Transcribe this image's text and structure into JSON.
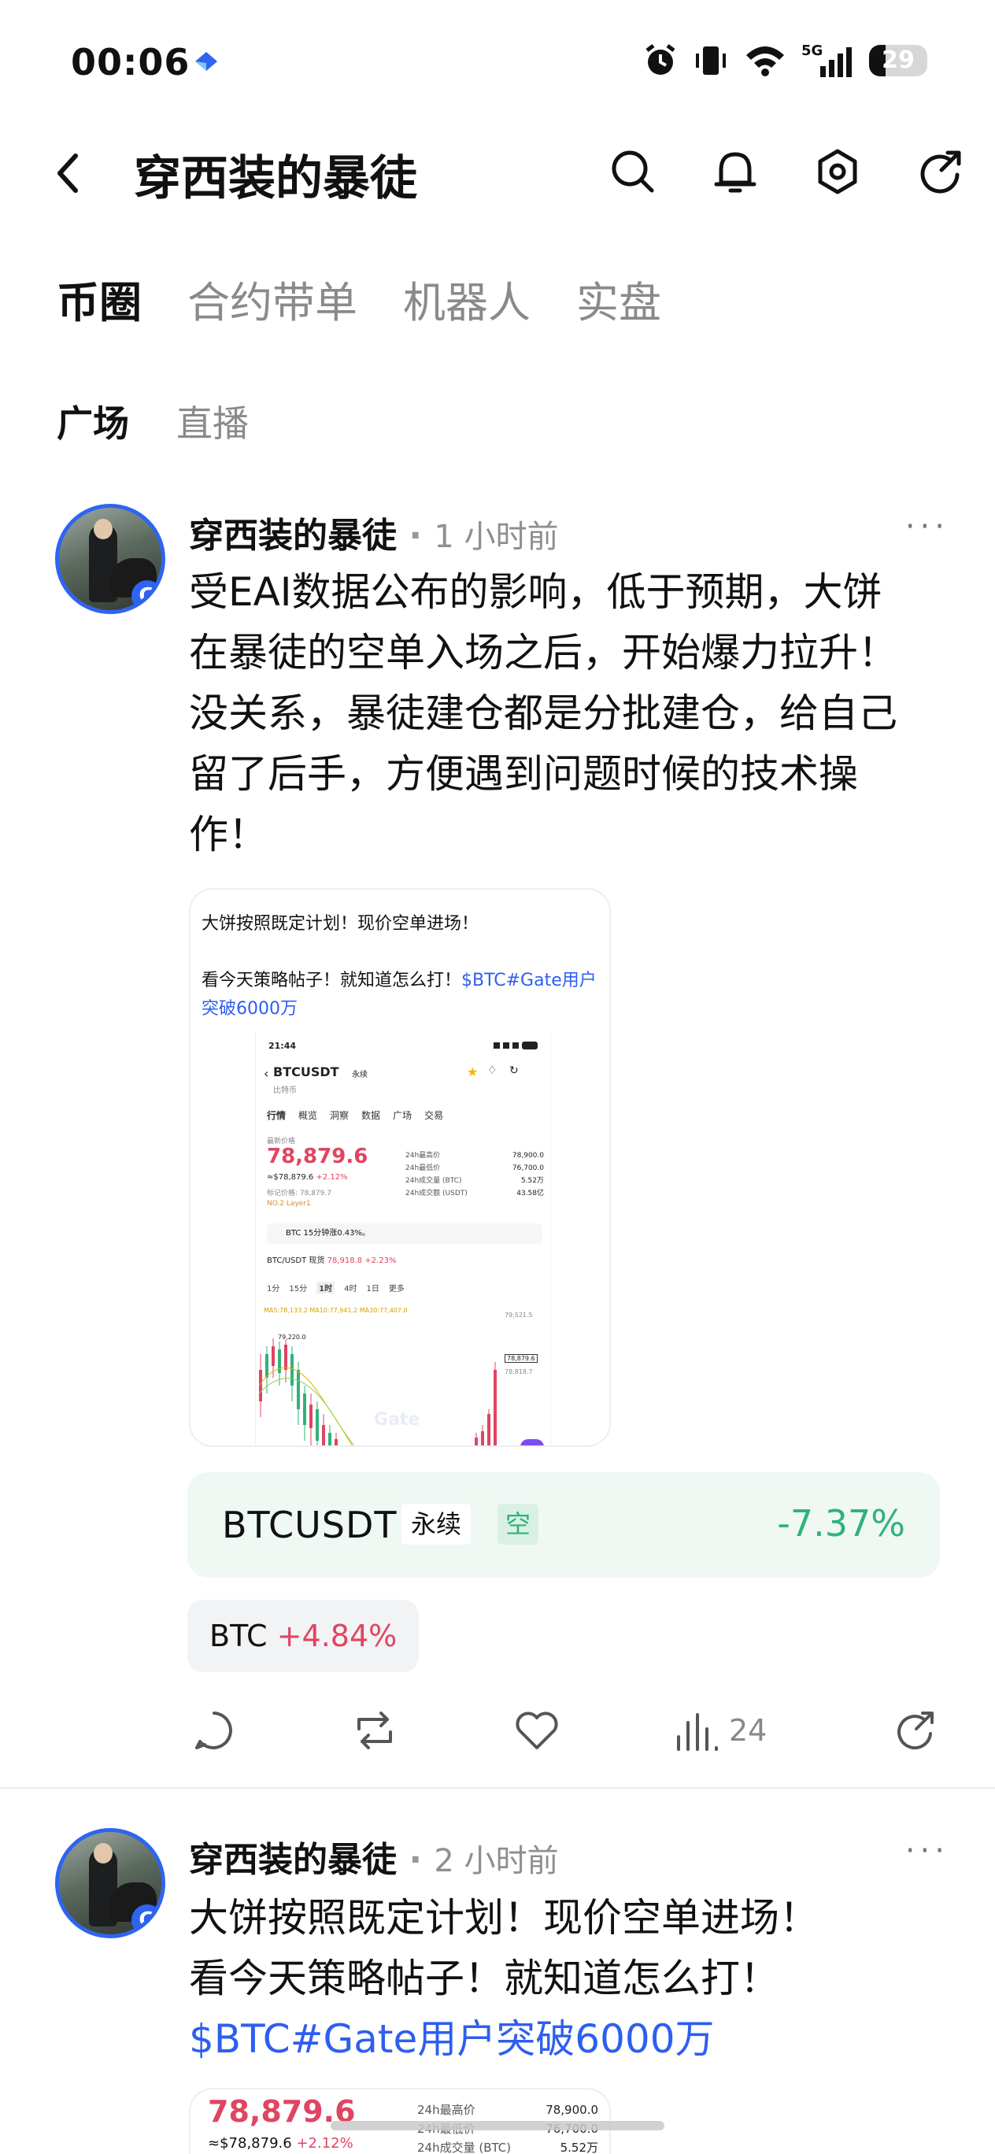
{
  "status": {
    "time": "00:06",
    "battery": "29",
    "network": "5G"
  },
  "header": {
    "title": "穿西装的暴徒"
  },
  "tabs": [
    "币圈",
    "合约带单",
    "机器人",
    "实盘"
  ],
  "subtabs": [
    "广场",
    "直播"
  ],
  "post1": {
    "author": "穿西装的暴徒",
    "dot": "·",
    "time": "1 小时前",
    "more": "···",
    "text_lines": [
      "受EAI数据公布的影响，低于预期，大饼",
      "在暴徒的空单入场之后，开始爆力拉升！",
      "没关系，暴徒建仓都是分批建仓，给自己",
      "留了后手，方便遇到问题时候的技术操",
      "作！"
    ],
    "card": {
      "line1": "大饼按照既定计划！现价空单进场！",
      "line2": "看今天策略帖子！就知道怎么打！",
      "link": "$BTC#Gate用户突破6000万",
      "screen": {
        "time": "21:44",
        "symbol": "BTCUSDT",
        "perp": "永续",
        "subtitle": "比特币",
        "tabs": [
          "行情",
          "概览",
          "洞察",
          "数据",
          "广场",
          "交易"
        ],
        "last_price_label": "最新价格",
        "price": "78,879.6",
        "fiat": "≈$78,879.6",
        "change": "+2.12%",
        "mark": "标记价格: 78,879.7",
        "rank": "NO.2",
        "layer": "Layer1",
        "stats": [
          [
            "24h最高价",
            "78,900.0"
          ],
          [
            "24h最低价",
            "76,700.0"
          ],
          [
            "24h成交量 (BTC)",
            "5.52万"
          ],
          [
            "24h成交额 (USDT)",
            "43.58亿"
          ]
        ],
        "alert": "BTC 15分钟涨0.43%。",
        "spot": "BTC/USDT 现货",
        "spot_price": "78,918.8",
        "spot_change": "+2.23%",
        "intervals": [
          "1分",
          "15分",
          "1时",
          "4时",
          "1日",
          "更多"
        ],
        "ma": "MA5:78,133.2  MA10:77,941.2  MA30:77,407.0",
        "high_mark": "79,220.0",
        "axis": [
          "79,521.5",
          "78,879.6",
          "78,818.7"
        ]
      }
    },
    "contract": {
      "symbol": "BTCUSDT",
      "type": "永续",
      "side": "空",
      "pct": "-7.37%"
    },
    "coin": {
      "symbol": "BTC",
      "change": "+4.84%"
    },
    "views": "24"
  },
  "post2": {
    "author": "穿西装的暴徒",
    "dot": "·",
    "time": "2 小时前",
    "more": "···",
    "text_lines": [
      "大饼按照既定计划！现价空单进场！",
      "看今天策略帖子！就知道怎么打！"
    ],
    "link": "$BTC#Gate用户突破6000万",
    "snippet": {
      "price": "78,879.6",
      "fiat": "≈$78,879.6",
      "change": "+2.12%",
      "stats": [
        [
          "24h最高价",
          "78,900.0"
        ],
        [
          "24h最低价",
          "76,700.0"
        ],
        [
          "24h成交量 (BTC)",
          "5.52万"
        ]
      ]
    }
  },
  "colors": {
    "accent": "#2e5ef0",
    "up": "#e04561",
    "down": "#2fb27b"
  }
}
